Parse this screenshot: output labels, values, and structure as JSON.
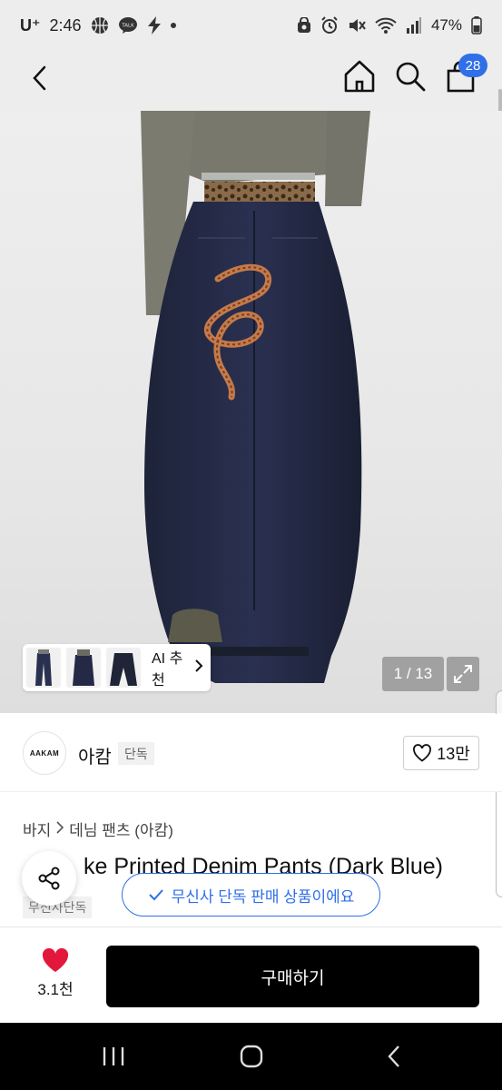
{
  "status_bar": {
    "carrier": "U⁺",
    "time": "2:46",
    "notif_talk": "TALK",
    "battery": "47%"
  },
  "nav": {
    "cart_count": "28"
  },
  "gallery": {
    "ai_recommend_label": "AI 추천",
    "counter": "1 / 13"
  },
  "brand": {
    "logo_text": "AAKAM",
    "name": "아캄",
    "tag": "단독",
    "likes": "13만"
  },
  "breadcrumb": {
    "level1": "바지",
    "level2": "데님 팬츠 (아캄)"
  },
  "product": {
    "title": "Snake Printed Denim Pants (Dark Blue)",
    "visible_title": "ke Printed Denim Pants (Dark Blue)",
    "exclusive_tag": "무신사단독"
  },
  "toast": {
    "text": "무신사 단독 판매 상품이에요"
  },
  "bottom_bar": {
    "favorite_count": "3.1천",
    "buy_label": "구매하기"
  },
  "colors": {
    "accent_blue": "#2f6fe8",
    "heart_red": "#e3173b",
    "buy_black": "#000000"
  }
}
